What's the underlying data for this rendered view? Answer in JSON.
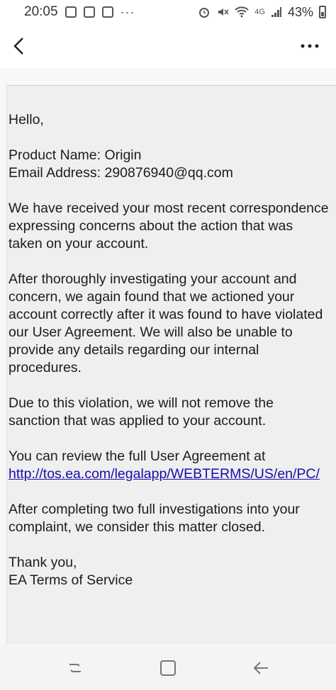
{
  "status": {
    "time": "20:05",
    "network": "4G",
    "battery": "43%"
  },
  "email": {
    "greeting": "Hello,",
    "product_line": "Product Name: Origin",
    "email_label": "Email Address: ",
    "email_value": "290876940@qq.com",
    "p1": [
      "We have received your most recent correspondence",
      "expressing concerns about the action that was",
      "taken on your account."
    ],
    "p2": [
      "After thoroughly investigating your account and",
      "concern, we again found that we actioned your",
      "account correctly after it was found to have violated",
      "our User Agreement. We will also be unable to",
      "provide any details regarding our internal",
      "procedures."
    ],
    "p3": [
      "Due to this violation, we will not remove the",
      "sanction that was applied to your account."
    ],
    "p4_text": "You can review the full User Agreement at",
    "p4_link": "http://tos.ea.com/legalapp/WEBTERMS/US/en/PC/",
    "p5": [
      "After completing two full investigations into your",
      "complaint, we consider this matter closed."
    ],
    "signoff": "Thank you,",
    "signature": "EA Terms of Service"
  },
  "icons": {
    "back": "chevron-left-icon",
    "more": "more-vertical-icon",
    "recents": "recents-icon",
    "home": "home-icon",
    "nav_back": "back-arrow-icon"
  }
}
